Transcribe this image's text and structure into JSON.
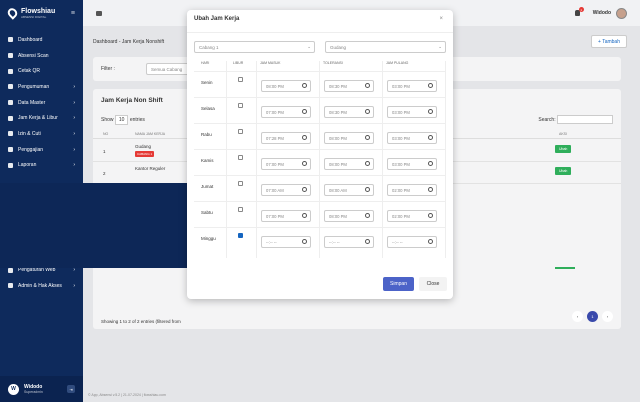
{
  "brand": {
    "name": "Flowshiau",
    "tagline": "ABSENSI DIGITAL"
  },
  "sidebar": {
    "items": [
      {
        "label": "Dashboard",
        "has_children": false
      },
      {
        "label": "Absensi Scan",
        "has_children": false
      },
      {
        "label": "Cetak QR",
        "has_children": false
      },
      {
        "label": "Pengumuman",
        "has_children": true
      },
      {
        "label": "Data Master",
        "has_children": true
      },
      {
        "label": "Jam Kerja & Libur",
        "has_children": true
      },
      {
        "label": "Izin & Cuti",
        "has_children": true
      },
      {
        "label": "Penggajian",
        "has_children": true
      },
      {
        "label": "Laporan",
        "has_children": true
      },
      {
        "label": "Pengaturan Web",
        "has_children": true
      },
      {
        "label": "Admin & Hak Akses",
        "has_children": true
      }
    ],
    "user": {
      "name": "Widodo",
      "role": "Superadmin",
      "initial": "W"
    }
  },
  "topbar": {
    "notification_count": "1",
    "user_name": "Widodo"
  },
  "breadcrumb": "Dashboard  -  Jam Kerja Nonshift",
  "add_button": "+ Tambah",
  "filter": {
    "label": "Filter :",
    "placeholder": "Semua Cabang"
  },
  "table": {
    "title": "Jam Kerja Non Shift",
    "show_label": "Show",
    "entries_value": "10",
    "entries_label": "entries",
    "search_label": "Search:",
    "headers": [
      "NO",
      "NAMA JAM KERJA",
      "AKSI"
    ],
    "rows": [
      {
        "no": "1",
        "name": "Gudang",
        "badge": "CABANG 1",
        "action": "Ubah"
      },
      {
        "no": "2",
        "name": "Kantor Reguler",
        "badge": "",
        "action": "Ubah"
      }
    ],
    "footer": "Showing 1 to 2 of 2 entries (filtered from",
    "page": "1",
    "prev": "‹",
    "next": "›"
  },
  "footer_text": "© App, Absensi v.5.2 | 21-07-2024 | flowshiau.com",
  "modal": {
    "title": "Ubah Jam Kerja",
    "close_icon": "×",
    "branch_select": "Cabang 1",
    "location_select": "Gudang",
    "headers": {
      "day": "HARI",
      "off": "LIBUR",
      "in": "JAM MASUK",
      "break": "TOLERANSI",
      "out": "JAM PULANG"
    },
    "rows": [
      {
        "day": "Senin",
        "off": false,
        "in": "08:00 PM",
        "break": "08:30 PM",
        "out": "03:00 PM"
      },
      {
        "day": "Selasa",
        "off": false,
        "in": "07:00 PM",
        "break": "08:30 PM",
        "out": "03:00 PM"
      },
      {
        "day": "Rabu",
        "off": false,
        "in": "07:28 PM",
        "break": "08:00 PM",
        "out": "03:00 PM"
      },
      {
        "day": "Kamis",
        "off": false,
        "in": "07:00 PM",
        "break": "08:00 PM",
        "out": "03:00 PM"
      },
      {
        "day": "Jumat",
        "off": false,
        "in": "07:00 AM",
        "break": "08:00 AM",
        "out": "02:00 PM"
      },
      {
        "day": "Sabtu",
        "off": false,
        "in": "07:00 PM",
        "break": "08:00 PM",
        "out": "02:00 PM"
      },
      {
        "day": "Minggu",
        "off": true,
        "in": "--:-- --",
        "break": "--:-- --",
        "out": "--:-- --"
      }
    ],
    "save_label": "Simpan",
    "close_label": "Close"
  }
}
